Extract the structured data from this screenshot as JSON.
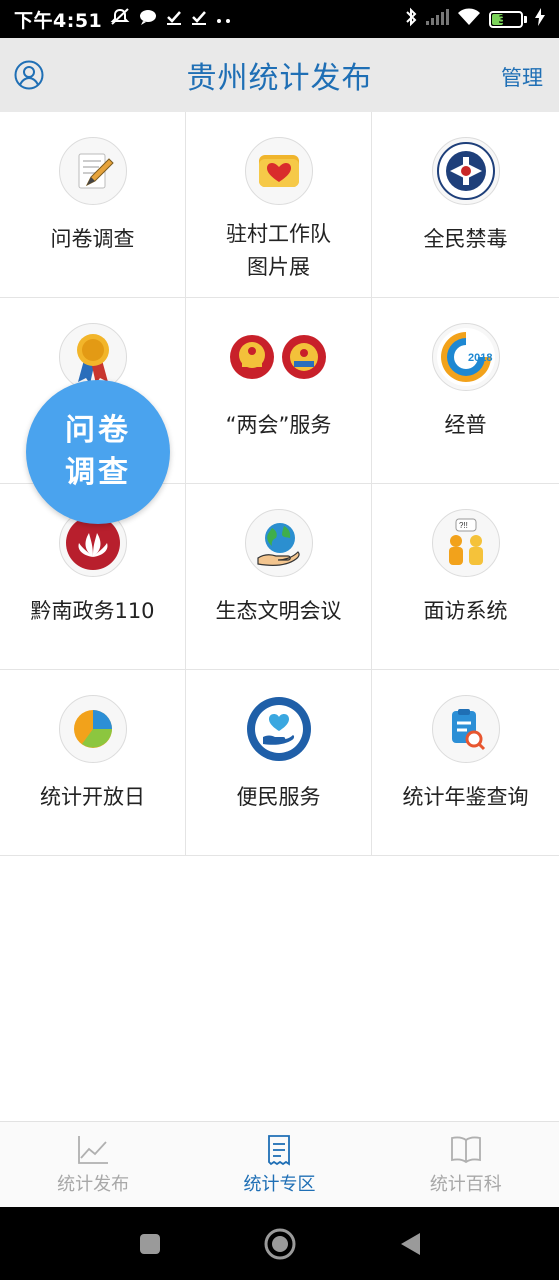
{
  "status_bar": {
    "time": "下午4:51",
    "left_icons": [
      "muted-icon",
      "chat-icon",
      "download-check-icon",
      "download-check-icon",
      "more-dots-icon"
    ],
    "battery_level": "36",
    "colors": {
      "battery_fill": "#7bd35a"
    }
  },
  "header": {
    "title": "贵州统计发布",
    "manage_label": "管理",
    "colors": {
      "accent": "#1f6fb5",
      "background": "#e9e9e9"
    }
  },
  "grid": {
    "items": [
      {
        "label": "问卷调查",
        "icon": "survey-pencil-icon"
      },
      {
        "label": "驻村工作队\n图片展",
        "icon": "heart-folder-icon"
      },
      {
        "label": "全民禁毒",
        "icon": "anti-drug-emblem-icon"
      },
      {
        "label": "",
        "icon": "medal-icon"
      },
      {
        "label": "“两会”服务",
        "icon": "national-emblems-icon"
      },
      {
        "label": "经普",
        "icon": "census-2018-icon"
      },
      {
        "label": "黔南政务110",
        "icon": "red-leaf-icon"
      },
      {
        "label": "生态文明会议",
        "icon": "globe-hand-icon"
      },
      {
        "label": "面访系统",
        "icon": "interview-people-icon"
      },
      {
        "label": "统计开放日",
        "icon": "pie-chart-icon"
      },
      {
        "label": "便民服务",
        "icon": "heart-hands-emblem-icon"
      },
      {
        "label": "统计年鉴查询",
        "icon": "document-search-icon"
      }
    ]
  },
  "floating_bubble": {
    "label": "问卷调查",
    "color": "#4aa3ee"
  },
  "tabs": [
    {
      "label": "统计发布",
      "icon": "line-chart-icon",
      "active": false
    },
    {
      "label": "统计专区",
      "icon": "receipt-icon",
      "active": true
    },
    {
      "label": "统计百科",
      "icon": "open-book-icon",
      "active": false
    }
  ],
  "nav_bar": {
    "buttons": [
      "recent-apps-icon",
      "home-icon",
      "back-icon"
    ]
  }
}
